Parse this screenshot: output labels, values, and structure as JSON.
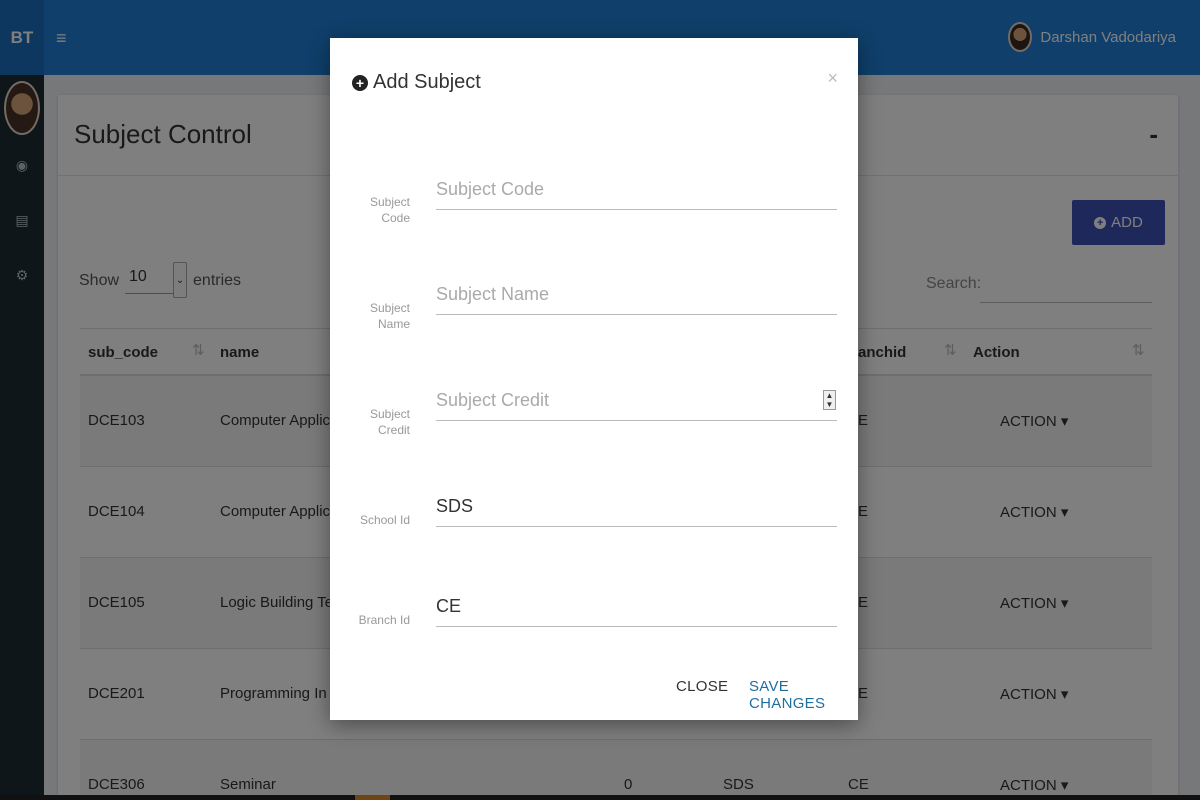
{
  "topbar": {
    "brand": "BT",
    "menu_icon": "hamburger-icon",
    "user_name": "Darshan Vadodariya"
  },
  "sidebar": {
    "icons": [
      "dashboard-icon",
      "document-icon",
      "settings-icon"
    ]
  },
  "panel": {
    "title": "Subject Control",
    "collapse": "-",
    "add_label": "ADD",
    "show_label": "Show",
    "show_value": "10",
    "entries_label": "entries",
    "search_label": "Search:"
  },
  "table": {
    "headers": [
      "sub_code",
      "name",
      "anchid",
      "Action"
    ],
    "rows": [
      {
        "code": "DCE103",
        "name": "Computer Applicatio",
        "col3": "",
        "col4": "",
        "branch": "E",
        "action": "ACTION"
      },
      {
        "code": "DCE104",
        "name": "Computer Applicatio",
        "col3": "",
        "col4": "",
        "branch": "E",
        "action": "ACTION"
      },
      {
        "code": "DCE105",
        "name": "Logic Building Techn",
        "col3": "",
        "col4": "",
        "branch": "E",
        "action": "ACTION"
      },
      {
        "code": "DCE201",
        "name": "Programming In C",
        "col3": "",
        "col4": "",
        "branch": "E",
        "action": "ACTION"
      },
      {
        "code": "DCE306",
        "name": "Seminar",
        "col3": "0",
        "col4": "SDS",
        "branch": "CE",
        "action": "ACTION"
      }
    ]
  },
  "modal": {
    "title": "Add Subject",
    "close_x": "×",
    "fields": {
      "code": {
        "label_1": "Subject",
        "label_2": "Code",
        "placeholder": "Subject Code",
        "value": ""
      },
      "name": {
        "label_1": "Subject",
        "label_2": "Name",
        "placeholder": "Subject Name",
        "value": ""
      },
      "credit": {
        "label_1": "Subject",
        "label_2": "Credit",
        "placeholder": "Subject Credit",
        "value": ""
      },
      "school": {
        "label": "School Id",
        "placeholder": "",
        "value": "SDS"
      },
      "branch": {
        "label": "Branch Id",
        "placeholder": "",
        "value": "CE"
      }
    },
    "close_label": "CLOSE",
    "save_label": "SAVE CHANGES"
  }
}
